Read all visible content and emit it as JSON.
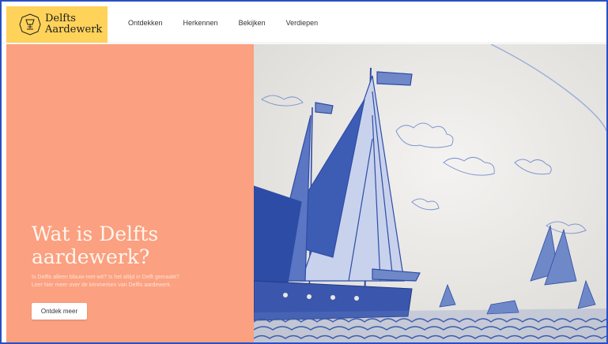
{
  "brand": {
    "line1": "Delfts",
    "line2": "Aardewerk",
    "logo_icon": "chalice-emblem-icon",
    "background_color": "#ffd25a"
  },
  "nav": {
    "items": [
      {
        "label": "Ontdekken"
      },
      {
        "label": "Herkennen"
      },
      {
        "label": "Bekijken"
      },
      {
        "label": "Verdiepen"
      }
    ]
  },
  "hero": {
    "title": "Wat is Delfts aardewerk?",
    "subtitle_line1": "Is Delfts alleen blauw-met-wit? Is het altijd in Delft gemaakt?",
    "subtitle_line2": "Leer hier meer over de kenmerken van Delfts aardewerk.",
    "cta_label": "Ontdek meer",
    "panel_color": "#fba080",
    "image_subject": "blue-and-white-ship-tile-image",
    "image_ink_color": "#2d4ca6"
  }
}
